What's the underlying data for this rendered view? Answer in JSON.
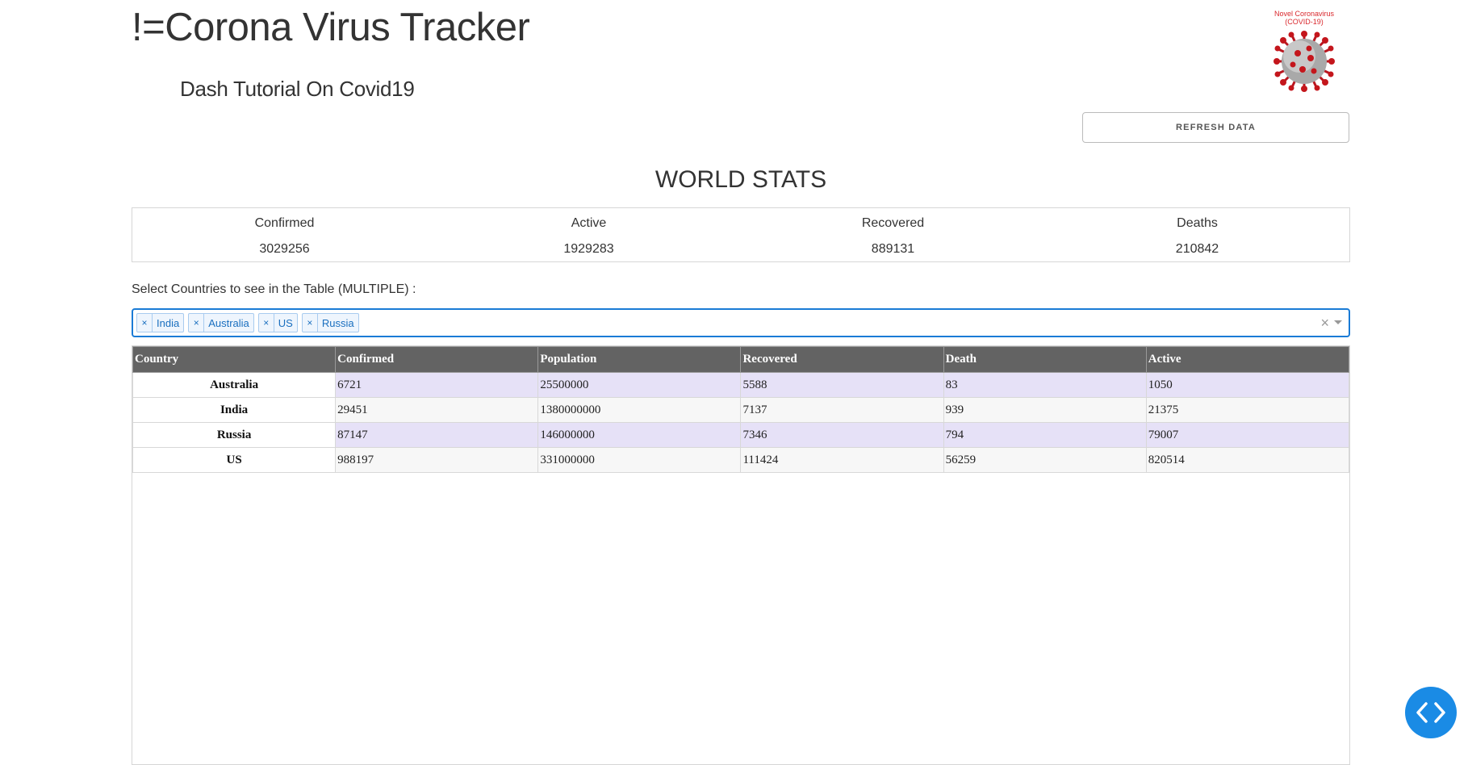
{
  "header": {
    "title": "!=Corona Virus Tracker",
    "subtitle": "Dash Tutorial On Covid19",
    "logo_caption": "Novel Coronavirus (COVID-19)",
    "refresh_label": "REFRESH DATA"
  },
  "world": {
    "title": "WORLD STATS",
    "stats": [
      {
        "label": "Confirmed",
        "value": "3029256"
      },
      {
        "label": "Active",
        "value": "1929283"
      },
      {
        "label": "Recovered",
        "value": "889131"
      },
      {
        "label": "Deaths",
        "value": "210842"
      }
    ]
  },
  "selector": {
    "label": "Select Countries to see in the Table (MULTIPLE) :",
    "selected": [
      "India",
      "Australia",
      "US",
      "Russia"
    ],
    "clear_glyph": "×",
    "remove_glyph": "×"
  },
  "table": {
    "columns": [
      "Country",
      "Confirmed",
      "Population",
      "Recovered",
      "Death",
      "Active"
    ],
    "rows": [
      [
        "Australia",
        "6721",
        "25500000",
        "5588",
        "83",
        "1050"
      ],
      [
        "India",
        "29451",
        "1380000000",
        "7137",
        "939",
        "21375"
      ],
      [
        "Russia",
        "87147",
        "146000000",
        "7346",
        "794",
        "79007"
      ],
      [
        "US",
        "988197",
        "331000000",
        "111424",
        "56259",
        "820514"
      ]
    ]
  },
  "colors": {
    "accent": "#1a7bd6",
    "header_bg": "#636363",
    "odd_row": "#e6e1f7",
    "even_row": "#f7f7f7",
    "logo_red": "#d9282d",
    "fab_blue": "#1a8be5"
  },
  "icons": {
    "logo": "coronavirus-icon",
    "fab": "code-brackets-icon"
  }
}
